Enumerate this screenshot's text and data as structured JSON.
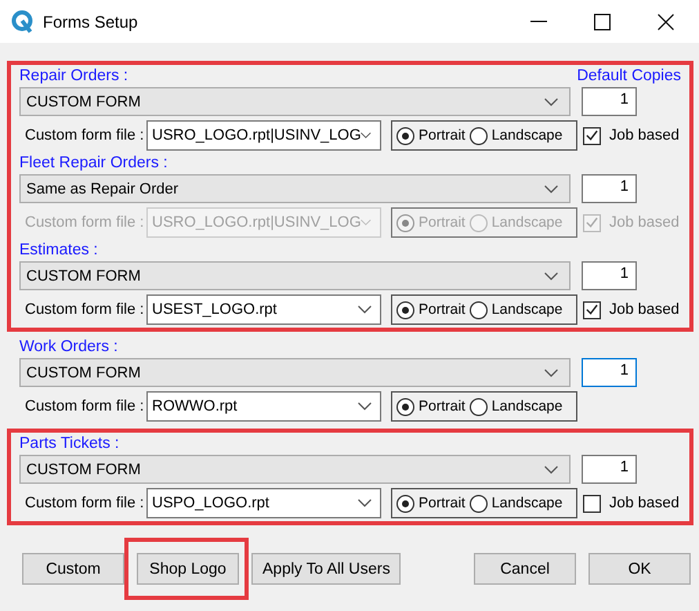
{
  "window": {
    "title": "Forms Setup"
  },
  "copies_header": "Default Copies",
  "groups": [
    {
      "highlighted": true,
      "sections": [
        {
          "label": "Repair Orders :",
          "form": "CUSTOM FORM",
          "copies": "1",
          "focused": false,
          "file_label": "Custom form file :",
          "file": "USRO_LOGO.rpt|USINV_LOG",
          "disabled": false,
          "orientation": [
            {
              "label": "Portrait",
              "selected": true
            },
            {
              "label": "Landscape",
              "selected": false
            }
          ],
          "job_based": {
            "label": "Job based",
            "checked": true
          }
        },
        {
          "label": "Fleet Repair Orders :",
          "form": "Same as Repair Order",
          "copies": "1",
          "focused": false,
          "file_label": "Custom form file :",
          "file": "USRO_LOGO.rpt|USINV_LOG",
          "disabled": true,
          "orientation": [
            {
              "label": "Portrait",
              "selected": true
            },
            {
              "label": "Landscape",
              "selected": false
            }
          ],
          "job_based": {
            "label": "Job based",
            "checked": true
          }
        },
        {
          "label": "Estimates :",
          "form": "CUSTOM FORM",
          "copies": "1",
          "focused": false,
          "file_label": "Custom form file :",
          "file": "USEST_LOGO.rpt",
          "disabled": false,
          "orientation": [
            {
              "label": "Portrait",
              "selected": true
            },
            {
              "label": "Landscape",
              "selected": false
            }
          ],
          "job_based": {
            "label": "Job based",
            "checked": true
          }
        }
      ]
    },
    {
      "highlighted": false,
      "sections": [
        {
          "label": "Work Orders :",
          "form": "CUSTOM FORM",
          "copies": "1",
          "focused": true,
          "file_label": "Custom form file :",
          "file": "ROWWO.rpt",
          "disabled": false,
          "orientation": [
            {
              "label": "Portrait",
              "selected": true
            },
            {
              "label": "Landscape",
              "selected": false
            }
          ]
        }
      ]
    },
    {
      "highlighted": true,
      "sections": [
        {
          "label": "Parts Tickets :",
          "form": "CUSTOM FORM",
          "copies": "1",
          "focused": false,
          "file_label": "Custom form file :",
          "file": "USPO_LOGO.rpt",
          "disabled": false,
          "orientation": [
            {
              "label": "Portrait",
              "selected": true
            },
            {
              "label": "Landscape",
              "selected": false
            }
          ],
          "job_based": {
            "label": "Job based",
            "checked": false
          }
        }
      ]
    }
  ],
  "buttons": [
    {
      "label": "Custom",
      "highlighted": false
    },
    {
      "label": "Shop Logo",
      "highlighted": true
    },
    {
      "label": "Apply To All Users",
      "highlighted": false
    },
    {
      "label": "Cancel",
      "highlighted": false
    },
    {
      "label": "OK",
      "highlighted": false
    }
  ]
}
